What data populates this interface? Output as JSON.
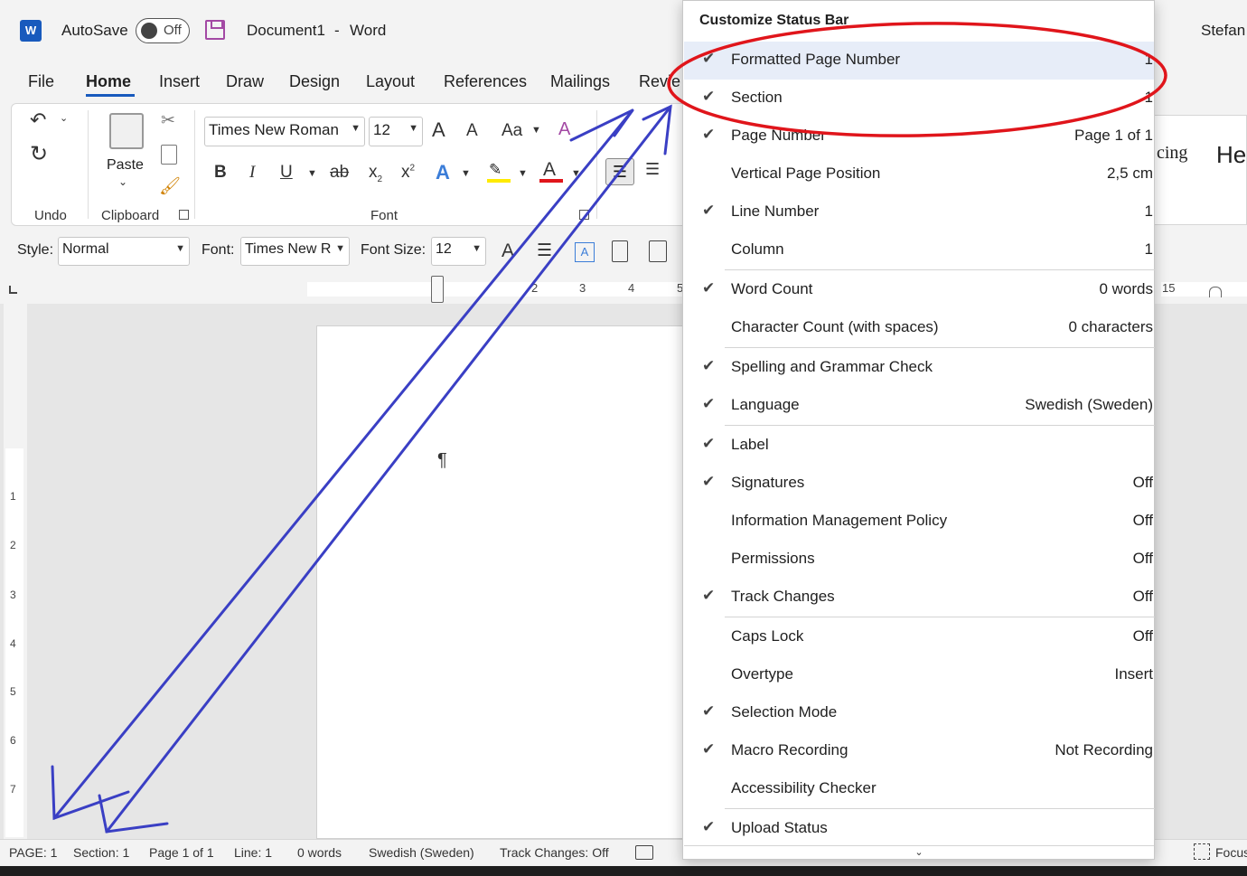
{
  "titlebar": {
    "logo": "W",
    "autosave_label": "AutoSave",
    "autosave_state": "Off",
    "document_name": "Document1",
    "separator": "-",
    "app_name": "Word",
    "user": "Stefan"
  },
  "tabs": [
    {
      "label": "File"
    },
    {
      "label": "Home"
    },
    {
      "label": "Insert"
    },
    {
      "label": "Draw"
    },
    {
      "label": "Design"
    },
    {
      "label": "Layout"
    },
    {
      "label": "References"
    },
    {
      "label": "Mailings"
    },
    {
      "label": "Revie"
    }
  ],
  "ribbon": {
    "undo_group": "Undo",
    "paste_label": "Paste",
    "clipboard_group": "Clipboard",
    "font_name": "Times New Roman",
    "font_size": "12",
    "font_group": "Font",
    "grow_font": "A",
    "shrink_font": "A",
    "change_case": "Aa",
    "bold": "B",
    "italic": "I",
    "underline": "U",
    "strikethrough": "ab",
    "subscript": "x",
    "superscript": "x",
    "text_effects": "A",
    "font_color": "A"
  },
  "stylebar": {
    "style_label": "Style:",
    "style_value": "Normal",
    "font_label": "Font:",
    "font_value": "Times New R",
    "size_label": "Font Size:",
    "size_value": "12"
  },
  "ruler": {
    "numbers": [
      "2",
      "3",
      "4",
      "5",
      "15"
    ]
  },
  "vruler": {
    "numbers": [
      "1",
      "2",
      "3",
      "4",
      "5",
      "6",
      "7"
    ]
  },
  "behind": {
    "spacing_fragment": "cing",
    "heading_fragment": "He"
  },
  "document": {
    "pilcrow": "¶"
  },
  "statusbar": {
    "page": "PAGE: 1",
    "section": "Section: 1",
    "page_of": "Page 1 of 1",
    "line": "Line: 1",
    "words": "0 words",
    "language": "Swedish (Sweden)",
    "track_changes": "Track Changes: Off",
    "focus": "Focus"
  },
  "menu": {
    "title": "Customize Status Bar",
    "items": [
      {
        "label": "Formatted Page Number",
        "value": "1",
        "checked": true
      },
      {
        "label": "Section",
        "value": "1",
        "checked": true
      },
      {
        "label": "Page Number",
        "value": "Page 1 of 1",
        "checked": true
      },
      {
        "label": "Vertical Page Position",
        "value": "2,5 cm",
        "checked": false
      },
      {
        "label": "Line Number",
        "value": "1",
        "checked": true
      },
      {
        "label": "Column",
        "value": "1",
        "checked": false
      },
      {
        "label": "Word Count",
        "value": "0 words",
        "checked": true
      },
      {
        "label": "Character Count (with spaces)",
        "value": "0 characters",
        "checked": false
      },
      {
        "label": "Spelling and Grammar Check",
        "value": "",
        "checked": true
      },
      {
        "label": "Language",
        "value": "Swedish (Sweden)",
        "checked": true
      },
      {
        "label": "Label",
        "value": "",
        "checked": true
      },
      {
        "label": "Signatures",
        "value": "Off",
        "checked": true
      },
      {
        "label": "Information Management Policy",
        "value": "Off",
        "checked": false
      },
      {
        "label": "Permissions",
        "value": "Off",
        "checked": false
      },
      {
        "label": "Track Changes",
        "value": "Off",
        "checked": true
      },
      {
        "label": "Caps Lock",
        "value": "Off",
        "checked": false
      },
      {
        "label": "Overtype",
        "value": "Insert",
        "checked": false
      },
      {
        "label": "Selection Mode",
        "value": "",
        "checked": true
      },
      {
        "label": "Macro Recording",
        "value": "Not Recording",
        "checked": true
      },
      {
        "label": "Accessibility Checker",
        "value": "",
        "checked": false
      },
      {
        "label": "Upload Status",
        "value": "",
        "checked": true
      }
    ],
    "check_glyph": "✔",
    "scroll_glyph": "⌄"
  },
  "annotation_colors": {
    "circle": "#e0151b",
    "arrows": "#3a3fc4"
  }
}
